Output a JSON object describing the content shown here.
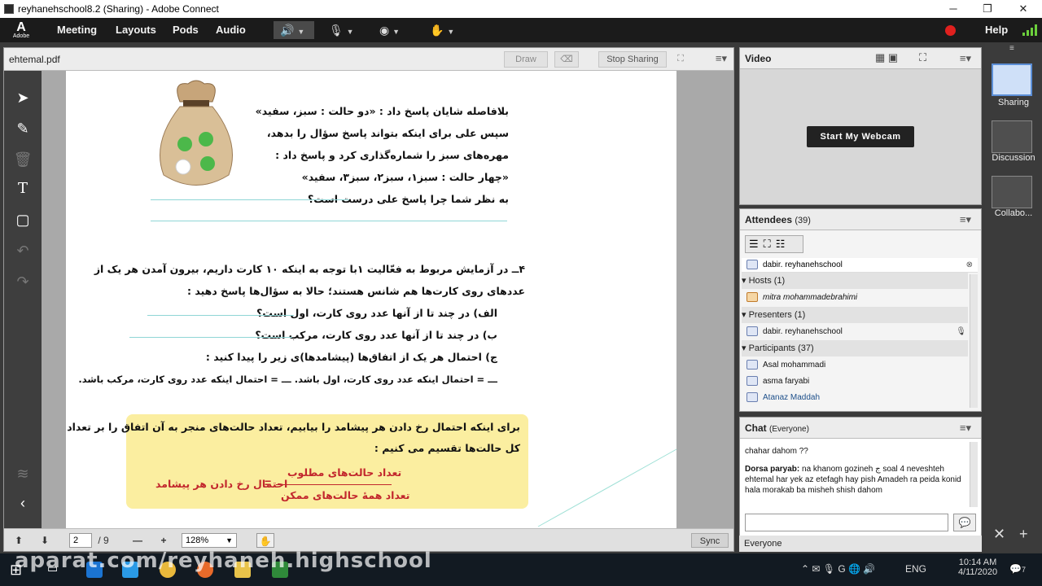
{
  "window": {
    "title": "reyhanehschool8.2 (Sharing) - Adobe Connect",
    "minimize": "─",
    "restore": "❐",
    "close": "✕"
  },
  "menu": {
    "logo": "A",
    "logo_sub": "Adobe",
    "items": [
      "Meeting",
      "Layouts",
      "Pods",
      "Audio"
    ],
    "help": "Help"
  },
  "share": {
    "filename": "ehtemal.pdf",
    "draw": "Draw",
    "stop_sharing": "Stop Sharing",
    "sync": "Sync",
    "page_current": "2",
    "page_total": "/ 9",
    "zoom": "128%",
    "doc_lines": [
      "بلافاصله شایان پاسخ داد : «دو حالت : سبز، سفید»",
      "سپس علی برای اینکه بتواند پاسخ سؤال را بدهد،",
      "مهره‌های سبز را شماره‌گذاری کرد و پاسخ داد :",
      "«چهار حالت : سبز۱، سبز۲، سبز۳، سفید»",
      "به نظر شما چرا پاسخ علی درست است؟"
    ],
    "q4_line1": "۴ــ در آزمایش مربوط به فعّالیت ۱با توجه به اینکه ۱۰ کارت داریم، بیرون آمدن هر یک از",
    "q4_line2": "عددهای روی کارت‌ها هم شانس هستند؛ حالا به سؤال‌ها پاسخ دهید :",
    "q4_a": "الف) در چند تا از آنها عدد روی کارت، اول است؟",
    "q4_b": "ب) در چند تا از آنها عدد روی کارت، مرکب است؟",
    "q4_c": "ج) احتمال هر یک از اتفاق‌ها (پیشامدها)ی زیر را پیدا کنید :",
    "q4_d": "ـــ = احتمال اینکه عدد روی کارت، اول باشد.    ـــ = احتمال اینکه عدد روی کارت، مرکب باشد.",
    "box_line1": "برای اینکه احتمال رخ دادن هر پیشامد را بیابیم، تعداد حالت‌های منجر به آن اتفاق را بر تعداد",
    "box_line2": "کل حالت‌ها تقسیم می کنیم :",
    "formula_left": "احتمال رخ دادن هر پیشامد",
    "formula_eq": "=",
    "formula_num": "تعداد حالت‌های مطلوب",
    "formula_den": "تعداد همهٔ حالت‌های ممکن"
  },
  "video": {
    "title": "Video",
    "webcam_button": "Start My Webcam"
  },
  "attendees": {
    "title": "Attendees",
    "count": "(39)",
    "search": "dabir. reyhanehschool",
    "hosts_label": "Hosts (1)",
    "hosts": [
      "mitra mohammadebrahimi"
    ],
    "presenters_label": "Presenters (1)",
    "presenters": [
      "dabir. reyhanehschool"
    ],
    "participants_label": "Participants (37)",
    "participants": [
      "Asal mohammadi",
      "asma faryabi",
      "Atanaz Maddah"
    ]
  },
  "chat": {
    "title": "Chat",
    "scope": "(Everyone)",
    "messages": [
      {
        "sender": "",
        "text": "chahar dahom ??"
      },
      {
        "sender": "Dorsa paryab:",
        "text": " na khanom gozineh ج soal 4 neveshteh ehtemal har yek az etefagh hay pish Amadeh ra peida konid hala morakab ba misheh shish dahom"
      }
    ],
    "recipient": "Everyone"
  },
  "layouts": [
    {
      "label": "Sharing"
    },
    {
      "label": "Discussion"
    },
    {
      "label": "Collabo..."
    }
  ],
  "taskbar": {
    "time": "10:14 AM",
    "date": "4/11/2020",
    "lang": "ENG",
    "notif": "7"
  },
  "watermark": "aparat.com/reyhaneh.highschool",
  "colors": {
    "accent": "#5b8ed6",
    "record": "#e0201e",
    "menubar": "#1b1b1b"
  }
}
